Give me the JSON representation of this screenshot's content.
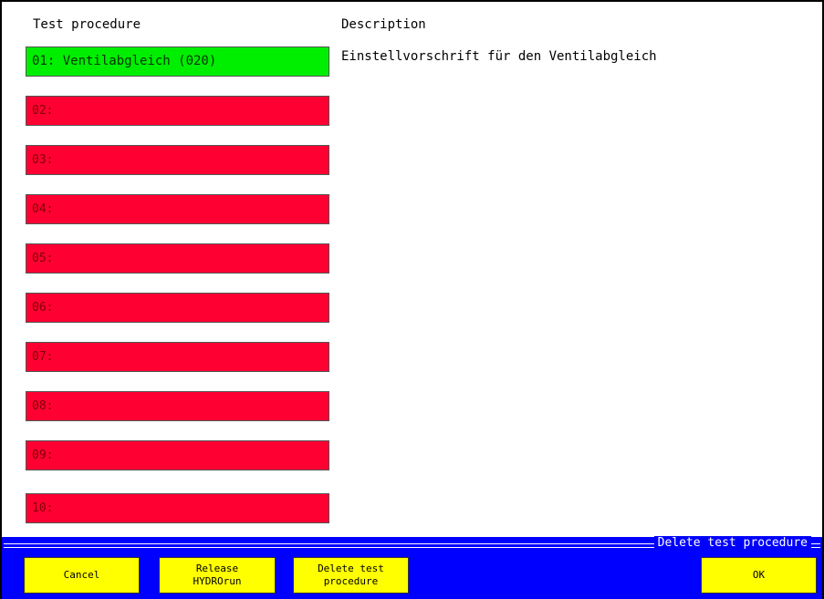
{
  "headers": {
    "procedure": "Test procedure",
    "description": "Description"
  },
  "procedures": [
    {
      "label": "01: Ventilabgleich (020)",
      "status": "active"
    },
    {
      "label": "02:",
      "status": "empty"
    },
    {
      "label": "03:",
      "status": "empty"
    },
    {
      "label": "04:",
      "status": "empty"
    },
    {
      "label": "05:",
      "status": "empty"
    },
    {
      "label": "06:",
      "status": "empty"
    },
    {
      "label": "07:",
      "status": "empty"
    },
    {
      "label": "08:",
      "status": "empty"
    },
    {
      "label": "09:",
      "status": "empty"
    },
    {
      "label": "10:",
      "status": "empty"
    }
  ],
  "selected_description": "Einstellvorschrift für den Ventilabgleich",
  "footer": {
    "title": "Delete test procedure",
    "buttons": {
      "cancel": "Cancel",
      "release": "Release\nHYDROrun",
      "delete": "Delete test\nprocedure",
      "ok": "OK"
    }
  },
  "colors": {
    "active": "#00ee00",
    "empty": "#ff0033",
    "bar": "#0000ff",
    "fkey": "#ffff00"
  }
}
